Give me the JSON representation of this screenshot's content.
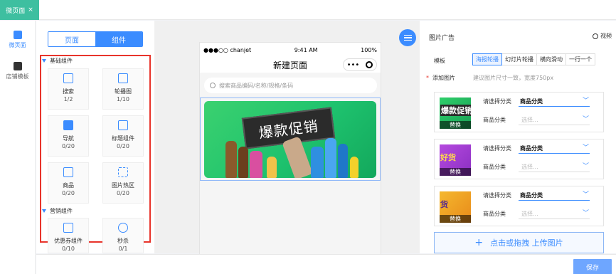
{
  "top_tab": {
    "label": "微页面",
    "close": "×"
  },
  "left_nav": [
    {
      "label": "微页面",
      "icon": "page-icon"
    },
    {
      "label": "店铺模板",
      "icon": "template-icon"
    }
  ],
  "panel": {
    "switch": {
      "page": "页面",
      "component": "组件"
    },
    "groups": {
      "basic": "基础组件",
      "marketing": "营销组件"
    },
    "basic_components": [
      {
        "name": "搜索",
        "count": "1/2",
        "icon": "search-icon"
      },
      {
        "name": "轮播图",
        "count": "1/10",
        "icon": "carousel-icon"
      },
      {
        "name": "导航",
        "count": "0/20",
        "icon": "nav-grid-icon"
      },
      {
        "name": "标题组件",
        "count": "0/20",
        "icon": "title-icon"
      },
      {
        "name": "商品",
        "count": "0/20",
        "icon": "goods-icon"
      },
      {
        "name": "图片热区",
        "count": "0/20",
        "icon": "image-hotspot-icon"
      }
    ],
    "marketing_components": [
      {
        "name": "优惠券组件",
        "count": "0/10",
        "icon": "coupon-icon"
      },
      {
        "name": "秒杀",
        "count": "0/1",
        "icon": "seckill-icon"
      }
    ]
  },
  "phone": {
    "carrier": "●●●○○ chanjet",
    "time": "9:41 AM",
    "battery": "100%",
    "title": "新建页面",
    "capsule_dots": "•••",
    "search_placeholder": "搜索商品编码/名称/规格/条码",
    "banner_text": "爆款促销"
  },
  "right_panel": {
    "title": "图片广告",
    "video_label": "视频",
    "template_label": "模板",
    "template_options": [
      "海报轮播",
      "幻灯片轮播",
      "横向滑动",
      "一行一个"
    ],
    "template_selected": "海报轮播",
    "add_image_label": "添加图片",
    "required_mark": "*",
    "add_image_hint": "建议图片尺寸一致，宽度750px",
    "cards": [
      {
        "thumb_text": "爆款促销",
        "replace": "替换",
        "select_label": "请选择分类",
        "select_value": "商品分类",
        "category_label": "商品分类",
        "category_placeholder": "选择..."
      },
      {
        "thumb_text": "好货",
        "replace": "替换",
        "select_label": "请选择分类",
        "select_value": "商品分类",
        "category_label": "商品分类",
        "category_placeholder": "选择..."
      },
      {
        "thumb_text": "货",
        "replace": "替换",
        "select_label": "请选择分类",
        "select_value": "商品分类",
        "category_label": "商品分类",
        "category_placeholder": "选择..."
      }
    ],
    "upload_plus": "+",
    "upload_label": "点击或拖拽 上传图片"
  },
  "bottom_bar": {
    "save_label": "保存"
  },
  "colors": {
    "accent": "#3b8cff",
    "tab_green": "#3ebfa0",
    "highlight_red": "#e8342b"
  }
}
